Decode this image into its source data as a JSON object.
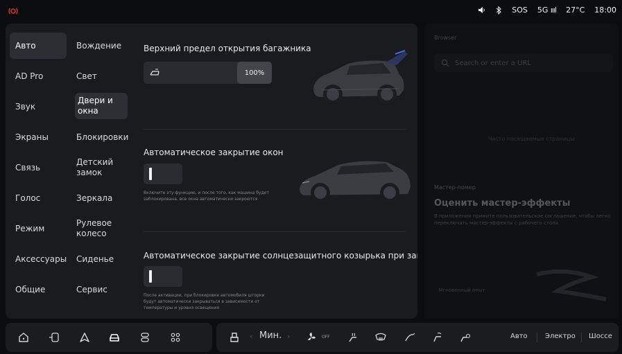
{
  "status": {
    "volume_icon": "volume-icon",
    "bluetooth_icon": "bluetooth-icon",
    "sos": "SOS",
    "network": "5G",
    "temperature": "27°C",
    "time": "18:00"
  },
  "nav_primary": [
    {
      "label": "Авто",
      "active": true
    },
    {
      "label": "AD Pro"
    },
    {
      "label": "Звук"
    },
    {
      "label": "Экраны"
    },
    {
      "label": "Связь"
    },
    {
      "label": "Голос"
    },
    {
      "label": "Режим"
    },
    {
      "label": "Аксессуары"
    },
    {
      "label": "Общие"
    }
  ],
  "nav_secondary": [
    {
      "label": "Вождение"
    },
    {
      "label": "Свет"
    },
    {
      "label": "Двери и окна",
      "active": true
    },
    {
      "label": "Блокировки"
    },
    {
      "label": "Детский замок"
    },
    {
      "label": "Зеркала"
    },
    {
      "label": "Рулевое колесо"
    },
    {
      "label": "Сиденье"
    },
    {
      "label": "Сервис"
    }
  ],
  "sections": {
    "trunk": {
      "title": "Верхний предел открытия багажника",
      "value": "100%",
      "level": 1.0
    },
    "windows": {
      "title": "Автоматическое закрытие окон",
      "description": "Включите эту функцию, и после того, как машина будет заблокирована, все окна автоматически закроются",
      "enabled": false
    },
    "sunshade": {
      "title": "Автоматическое закрытие солнцезащитного козырька при запирании",
      "description": "После активации, при блокировке автомобиля шторки будут автоматически закрываться в зависимости от температуры и уровня освещения",
      "enabled": false
    }
  },
  "browser": {
    "label": "Browser",
    "search_placeholder": "Search or enter a URL",
    "faded_hint": "Часто посещаемые страницы"
  },
  "master_wizard": {
    "label": "Мастер-помер",
    "title": "Оценить мастер-эффекты",
    "description": "В приложении примите пользовательское соглашение, чтобы легко переключать мастер-эффекты с рабочего стола",
    "instant": "Мгновенный опыт"
  },
  "dock": {
    "climate_mode": "Мин.",
    "fan_label": "OFF",
    "drive_modes": [
      "Авто",
      "Электро",
      "Шоссе"
    ]
  },
  "colors": {
    "accent_blue": "#3d6fd6",
    "alert_red": "#d3352b",
    "panel_bg": "#1a1b1f"
  }
}
